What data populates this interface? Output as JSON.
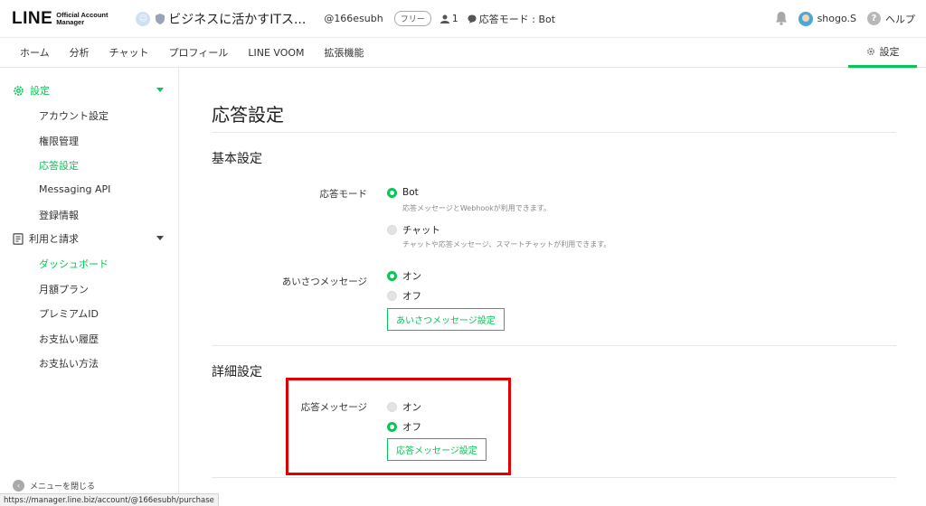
{
  "header": {
    "logo_main": "LINE",
    "logo_sub": "Official Account Manager",
    "account_name": "ビジネスに活かすITス...",
    "account_id": "@166esubh",
    "plan_badge": "フリー",
    "member_count": "1",
    "response_mode": "応答モード : Bot",
    "user_name": "shogo.S",
    "help_label": "ヘルプ"
  },
  "nav": {
    "tabs": [
      "ホーム",
      "分析",
      "チャット",
      "プロフィール",
      "LINE VOOM",
      "拡張機能"
    ],
    "settings_label": "設定"
  },
  "sidebar": {
    "group_settings": "設定",
    "settings_items": [
      "アカウント設定",
      "権限管理",
      "応答設定",
      "Messaging API",
      "登録情報"
    ],
    "group_billing": "利用と請求",
    "billing_items": [
      "ダッシュボード",
      "月額プラン",
      "プレミアムID",
      "お支払い履歴",
      "お支払い方法"
    ],
    "close_menu": "メニューを閉じる"
  },
  "status_url": "https://manager.line.biz/account/@166esubh/purchase",
  "main": {
    "title": "応答設定",
    "basic": {
      "title": "基本設定",
      "response_mode_label": "応答モード",
      "bot_label": "Bot",
      "bot_desc": "応答メッセージとWebhookが利用できます。",
      "chat_label": "チャット",
      "chat_desc": "チャットや応答メッセージ、スマートチャットが利用できます。",
      "greeting_label": "あいさつメッセージ",
      "on_label": "オン",
      "off_label": "オフ",
      "greeting_button": "あいさつメッセージ設定"
    },
    "detail": {
      "title": "詳細設定",
      "response_message_label": "応答メッセージ",
      "on_label": "オン",
      "off_label": "オフ",
      "response_button": "応答メッセージ設定"
    }
  },
  "colors": {
    "accent": "#06c755",
    "highlight": "#e00000"
  }
}
